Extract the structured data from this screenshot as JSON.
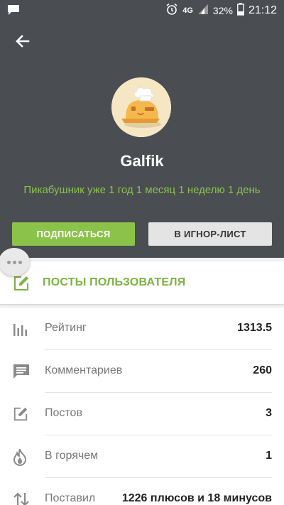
{
  "status_bar": {
    "network": "4G",
    "battery": "32%",
    "time": "21:12"
  },
  "profile": {
    "username": "Galfik",
    "tenure": "Пикабушник уже 1 год 1 месяц 1 неделю 1 день",
    "subscribe_label": "ПОДПИСАТЬСЯ",
    "ignore_label": "В ИГНОР-ЛИСТ"
  },
  "posts_link": {
    "label": "ПОСТЫ ПОЛЬЗОВАТЕЛЯ"
  },
  "stats": [
    {
      "label": "Рейтинг",
      "value": "1313.5",
      "icon": "bar-chart-icon"
    },
    {
      "label": "Комментариев",
      "value": "260",
      "icon": "comment-icon"
    },
    {
      "label": "Постов",
      "value": "3",
      "icon": "edit-icon"
    },
    {
      "label": "В горячем",
      "value": "1",
      "icon": "flame-icon"
    },
    {
      "label": "Поставил",
      "value": "1226 плюсов и 18 минусов",
      "icon": "sort-arrows-icon"
    }
  ],
  "colors": {
    "header_bg": "#4a4d52",
    "accent": "#8bc34a",
    "ignore_button": "#e4e4e4"
  }
}
